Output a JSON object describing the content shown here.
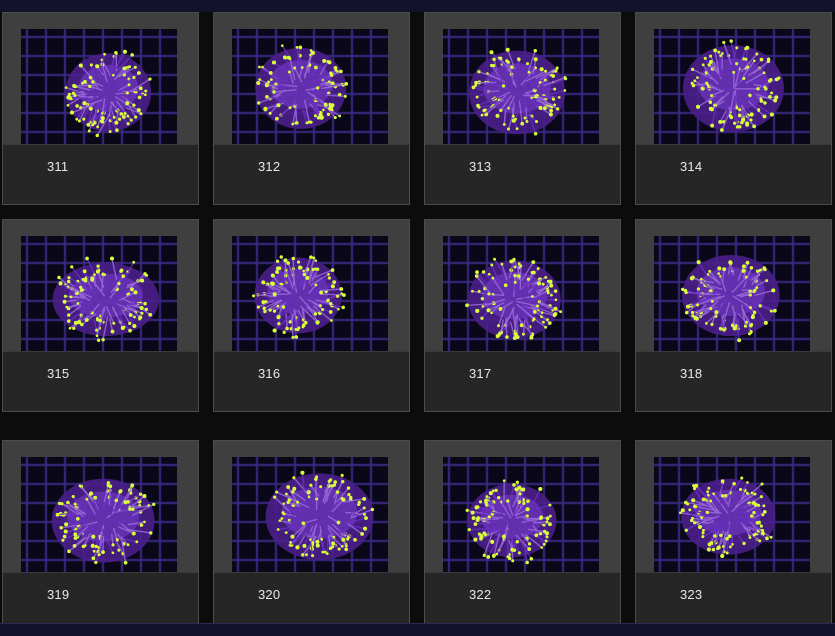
{
  "gallery": {
    "items": [
      {
        "label": "311",
        "photo": "coral-photo-icon"
      },
      {
        "label": "312",
        "photo": "coral-photo-icon"
      },
      {
        "label": "313",
        "photo": "coral-photo-icon"
      },
      {
        "label": "314",
        "photo": "coral-photo-icon"
      },
      {
        "label": "315",
        "photo": "coral-photo-icon"
      },
      {
        "label": "316",
        "photo": "coral-photo-icon"
      },
      {
        "label": "317",
        "photo": "coral-photo-icon"
      },
      {
        "label": "318",
        "photo": "coral-photo-icon"
      },
      {
        "label": "319",
        "photo": "coral-photo-icon"
      },
      {
        "label": "320",
        "photo": "coral-photo-icon"
      },
      {
        "label": "322",
        "photo": "coral-photo-icon"
      },
      {
        "label": "323",
        "photo": "coral-photo-icon"
      }
    ]
  },
  "colors": {
    "page_bg": "#161634",
    "card_bg": "#3f3f3f",
    "caption_bg": "#262626",
    "coral_purple": "#6a2fc0",
    "coral_tips": "#d8ff3a",
    "tank_grid": "#3e2a8a"
  }
}
